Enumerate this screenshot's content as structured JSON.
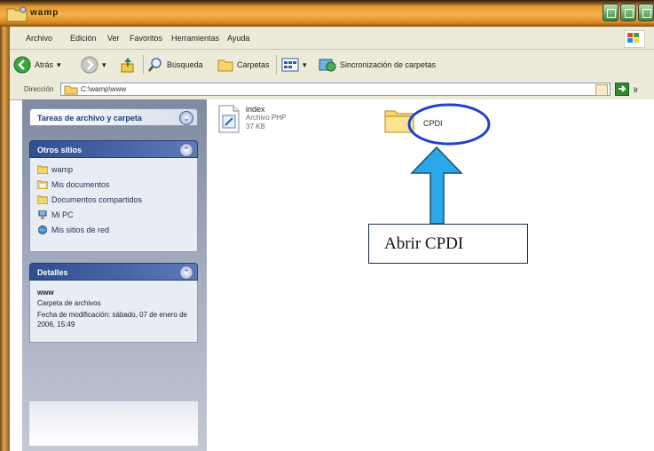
{
  "window": {
    "title": "wamp"
  },
  "menu": [
    "Archivo",
    "Edición",
    "Ver",
    "Favoritos",
    "Herramientas",
    "Ayuda"
  ],
  "toolbar": {
    "back": "Atrás",
    "search": "Búsqueda",
    "folders": "Carpetas",
    "sync": "Sincronización de carpetas"
  },
  "address": {
    "label": "Dirección",
    "value": "C:\\wamp\\www",
    "go": "Ir"
  },
  "taskpane": {
    "tasks_title": "Tareas de archivo y carpeta",
    "other_title": "Otros sitios",
    "places": [
      "wamp",
      "Mis documentos",
      "Documentos compartidos",
      "Mi PC",
      "Mis sitios de red"
    ],
    "details_title": "Detalles",
    "details": {
      "name": "www",
      "type": "Carpeta de archivos",
      "modified": "Fecha de modificación: sábado, 07 de enero de 2006, 15:49"
    }
  },
  "files": [
    {
      "name": "index",
      "type": "Archivo PHP",
      "size": "37 KB",
      "icon": "php-file-icon"
    },
    {
      "name": "CPDI",
      "icon": "folder-icon"
    }
  ],
  "annotation": {
    "text": "Abrir CPDI"
  },
  "colors": {
    "titlebar": "#f3b350",
    "arrow": "#2ca8e8",
    "highlight_ellipse": "#1f3fd6",
    "pane_dark_header": "#2f4f91"
  }
}
